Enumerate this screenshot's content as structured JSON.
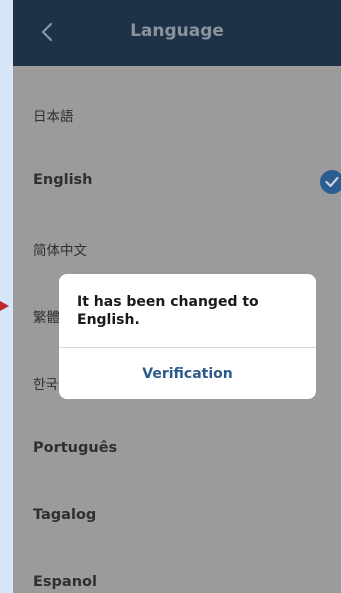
{
  "header": {
    "title": "Language",
    "back_icon": "chevron-left-icon"
  },
  "languages": [
    {
      "label": "日本語",
      "selected": false
    },
    {
      "label": "English",
      "selected": true
    },
    {
      "label": "简体中文",
      "selected": false
    },
    {
      "label": "繁體中文",
      "selected": false
    },
    {
      "label": "한국어",
      "selected": false
    },
    {
      "label": "Português",
      "selected": false
    },
    {
      "label": "Tagalog",
      "selected": false
    },
    {
      "label": "Espanol",
      "selected": false
    }
  ],
  "dialog": {
    "message": "It has been changed to English.",
    "button_label": "Verification"
  },
  "colors": {
    "header_bg": "#1e3247",
    "accent": "#2b5d91",
    "dialog_button": "#2d5a8c",
    "pointer": "#c1272d"
  },
  "icons": {
    "selected": "check-circle-icon",
    "annotation": "arrow-pointer-icon"
  }
}
